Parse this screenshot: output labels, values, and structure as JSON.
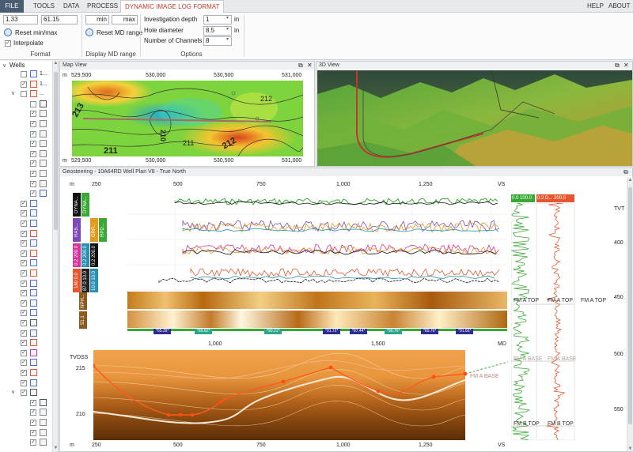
{
  "menu": {
    "file": "FILE",
    "tools": "TOOLS",
    "data": "DATA",
    "process": "PROCESS",
    "active_tab": "DYNAMIC IMAGE LOG FORMAT",
    "help": "HELP",
    "about": "ABOUT"
  },
  "format": {
    "min_value": "1.33",
    "max_value": "61.15",
    "reset_label": "Reset min/max",
    "interpolate_label": "Interpolate",
    "interpolate_checked": "✓",
    "group_label": "Format"
  },
  "md_range": {
    "min_label": "min",
    "max_label": "max",
    "reset_label": "Reset MD range",
    "group_label": "Display MD range"
  },
  "options": {
    "depth_label": "Investigation depth",
    "depth_value": "1",
    "depth_unit": "in",
    "diameter_label": "Hole diameter",
    "diameter_value": "8.5",
    "diameter_unit": "in",
    "channels_label": "Number of Channels",
    "channels_value": "8",
    "group_label": "Options"
  },
  "tree": {
    "root_label": "Wells",
    "item1": "1...",
    "item2": "1...",
    "item3": "..."
  },
  "map_view": {
    "title": "Map View",
    "x_ticks": [
      "529,500",
      "530,000",
      "530,500",
      "531,000"
    ],
    "unit": "m",
    "contours": [
      "213",
      "212",
      "211",
      "210",
      "212",
      "211"
    ]
  },
  "view3d": {
    "title": "3D View"
  },
  "geo": {
    "title": "Geosteering - 10A64RD Well Plan V8 - True North",
    "top_unit": "m",
    "top_ticks": [
      "250",
      "500",
      "750",
      "1,000",
      "1,250"
    ],
    "top_end": "VS",
    "md_ticks": [
      "1,000",
      "1,500"
    ],
    "md_label": "MD",
    "tvdss_label": "TVDSS",
    "tvdss_ticks": [
      "215",
      "210"
    ],
    "bottom_unit": "m",
    "bottom_ticks": [
      "250",
      "500",
      "750",
      "1,000",
      "1,250"
    ],
    "bottom_end": "VS",
    "track_labels": [
      "DYNA...",
      "DYNA...",
      "RAS...",
      "GRP...",
      "RPD...",
      "0.2  200.0",
      "0.2  200.0",
      "0.2  200.0",
      "180  0.0",
      "87.0  10.0",
      "10.0  10.0",
      "NPH...",
      "51.1"
    ],
    "dip_badges": [
      "*65.39*",
      "*89.62*",
      "*90.21*",
      "*91.72*",
      "*87.44*",
      "*90.76*",
      "*89.76*",
      "*91.65*"
    ],
    "fm_base": "FM A BASE"
  },
  "right_logs": {
    "gr_range": "0.0  100.0",
    "res_range": "0.2  D...  200.0",
    "tvt_label": "TVT",
    "tvt_ticks": [
      "400",
      "450",
      "500",
      "550"
    ],
    "fm_a_top": "FM A TOP",
    "fm_a_base": "FM A BASE",
    "fm_b_top": "FM B TOP"
  },
  "colors": {
    "accent": "#c0392b",
    "file_bg": "#4a5c72",
    "gr_green": "#39a935",
    "res_red": "#e4572e"
  }
}
